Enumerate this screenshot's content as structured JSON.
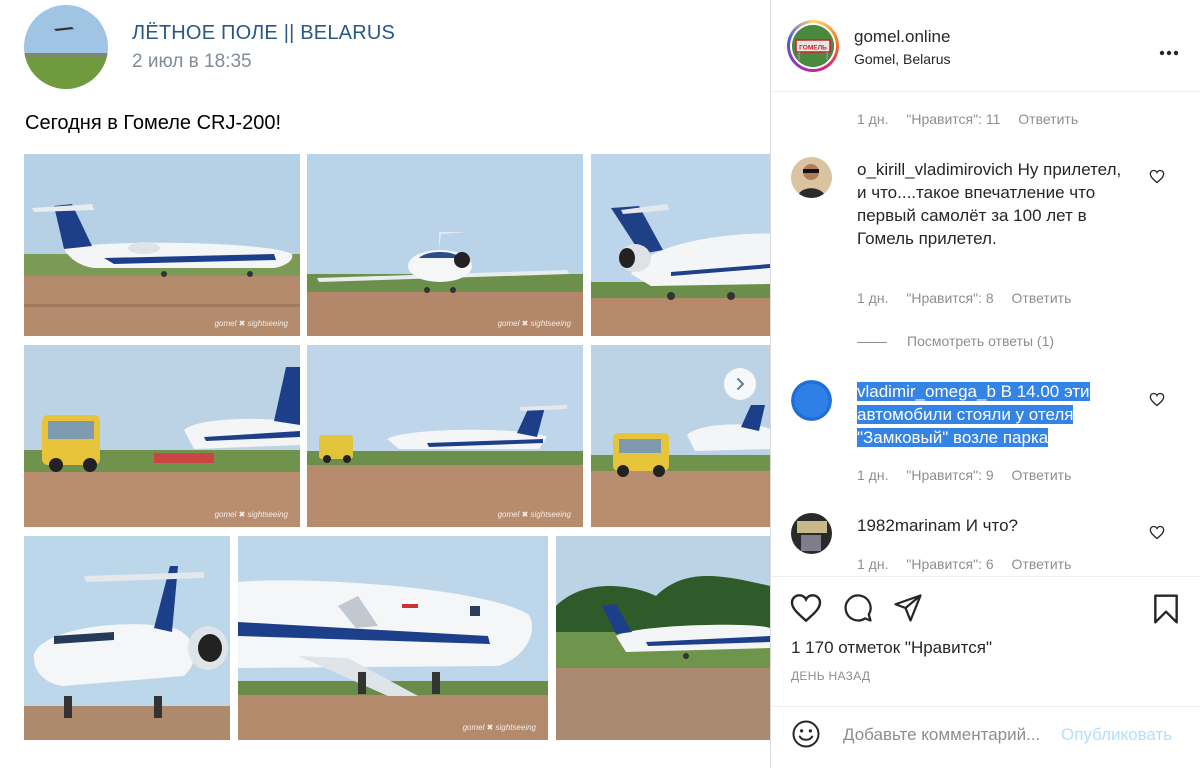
{
  "post": {
    "author": "ЛЁТНОЕ ПОЛЕ || BELARUS",
    "date": "2 июл в 18:35",
    "text": "Сегодня в Гомеле CRJ-200!",
    "watermark": "gomel ✖ sightseeing"
  },
  "instagram": {
    "username": "gomel.online",
    "location": "Gomel, Belarus",
    "avatar_sign": "ГОМЕЛЬ",
    "top_meta": {
      "time": "1 дн.",
      "likes": "\"Нравится\": 11",
      "reply": "Ответить"
    },
    "comments": [
      {
        "user": "o_kirill_vladimirovich",
        "text": "Ну прилетел, и что....такое впечатление что первый самолёт за 100 лет в Гомель прилетел.",
        "time": "1 дн.",
        "likes": "\"Нравится\": 8",
        "reply": "Ответить"
      },
      {
        "user": "vladimir_omega_b",
        "text": "В 14.00 эти автомобили стояли у отеля \"Замковый\" возле парка",
        "time": "1 дн.",
        "likes": "\"Нравится\": 9",
        "reply": "Ответить"
      },
      {
        "user": "1982marinam",
        "text": "И что?",
        "time": "1 дн.",
        "likes": "\"Нравится\": 6",
        "reply": "Ответить"
      }
    ],
    "view_replies": "Посмотреть ответы (1)",
    "likes_total": "1 170 отметок \"Нравится\"",
    "time_ago": "ДЕНЬ НАЗАД",
    "comment_placeholder": "Добавьте комментарий...",
    "publish": "Опубликовать"
  },
  "colors": {
    "vk_link": "#2a5885",
    "vk_muted": "#818c99",
    "ig_muted": "#8e8e8e",
    "ig_publish_disabled": "#b2dffc",
    "selection": "#3384e5"
  },
  "icons": [
    "chevron-right-icon",
    "more-icon",
    "heart-icon",
    "comment-icon",
    "share-icon",
    "bookmark-icon",
    "emoji-icon"
  ]
}
